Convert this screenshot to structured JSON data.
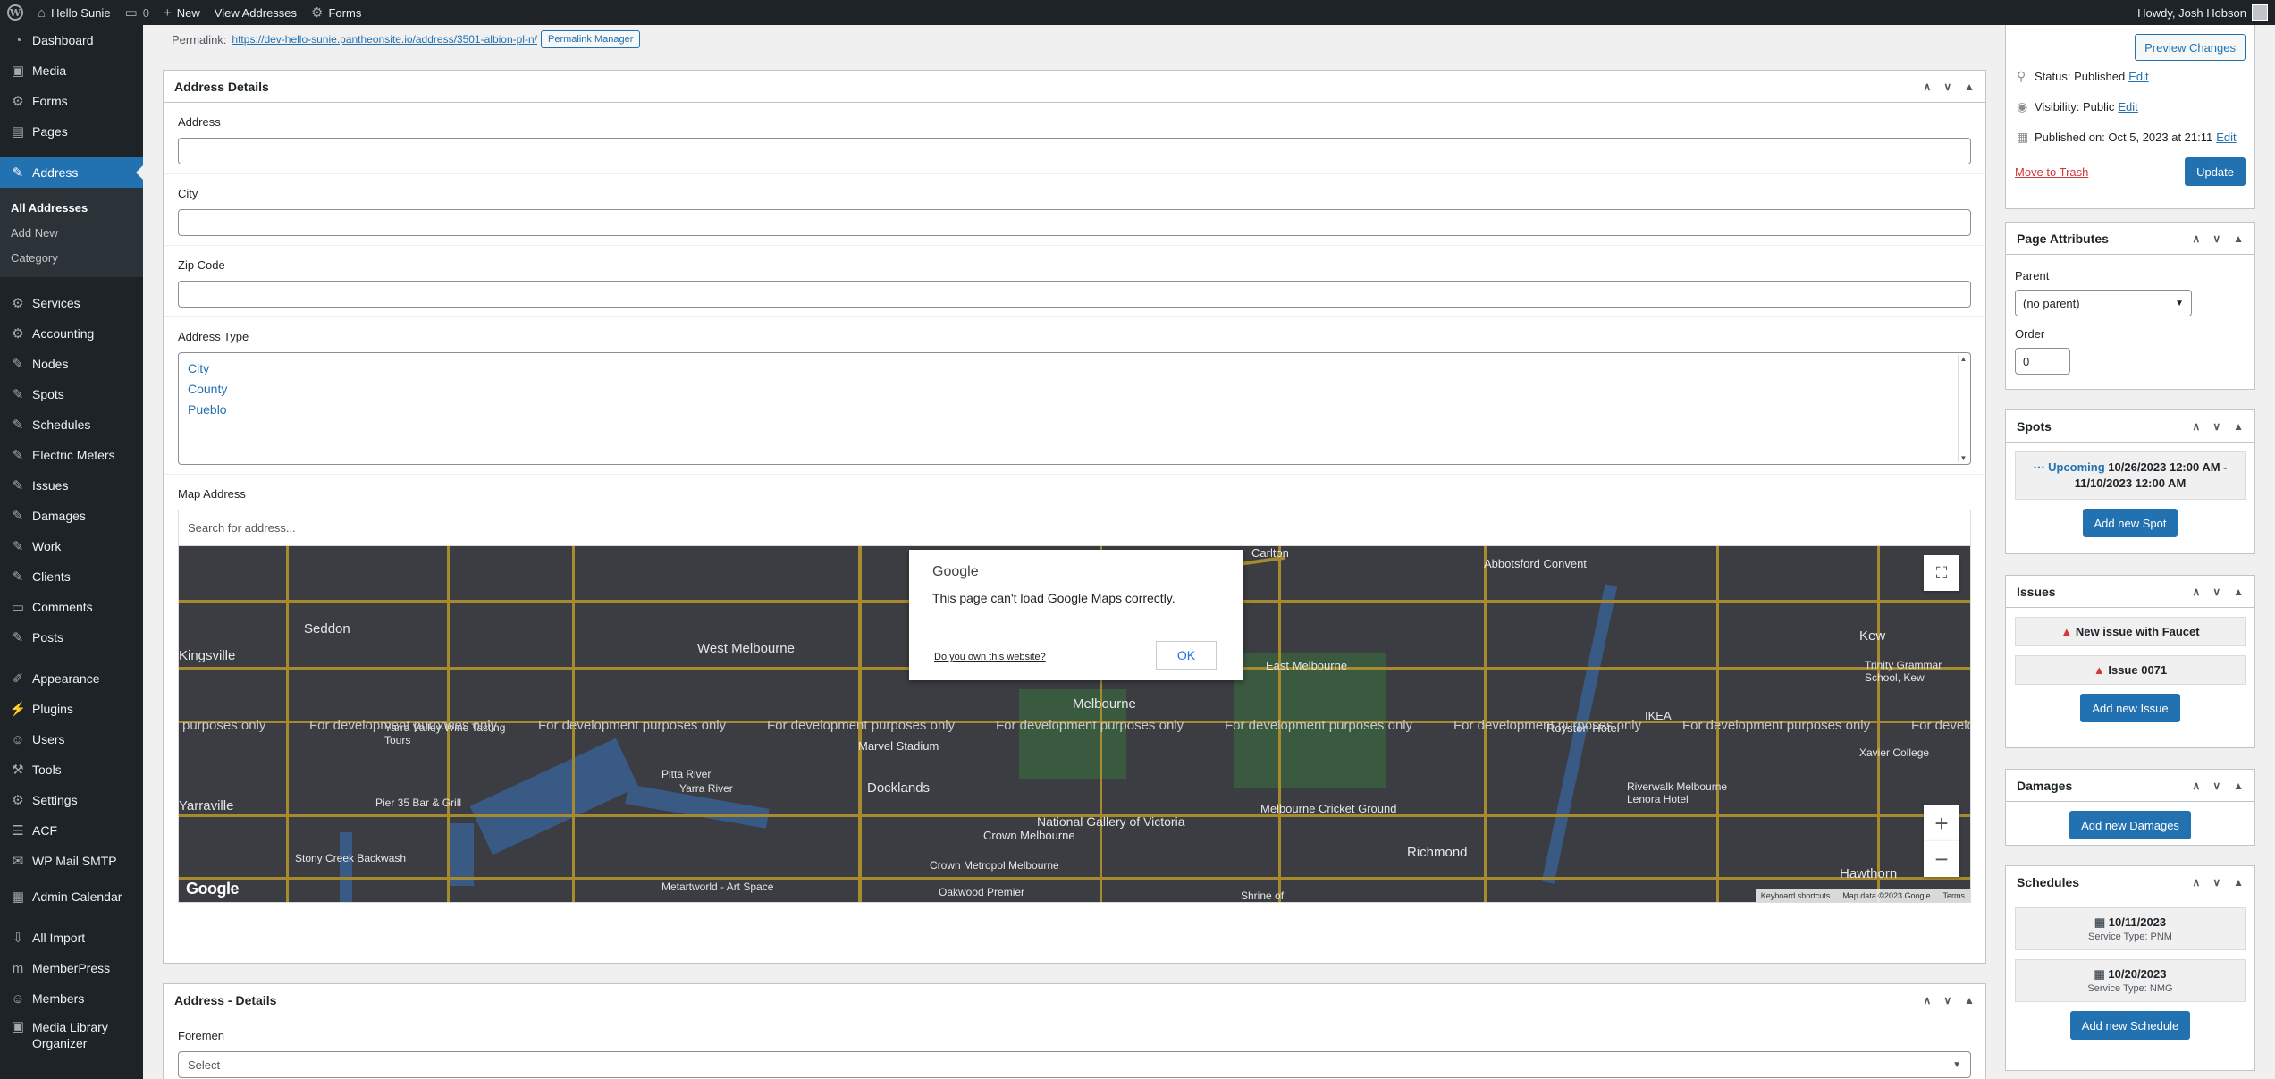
{
  "adminbar": {
    "site_name": "Hello Sunie",
    "comments_count": "0",
    "new_label": "New",
    "view_label": "View Addresses",
    "forms_label": "Forms",
    "howdy": "Howdy, Josh Hobson"
  },
  "sidebar": {
    "items_top": [
      {
        "label": "Dashboard",
        "icon": "dashboard-icon",
        "glyph": "◔"
      },
      {
        "label": "Media",
        "icon": "media-icon",
        "glyph": "▣"
      },
      {
        "label": "Forms",
        "icon": "forms-icon",
        "glyph": "⚙"
      },
      {
        "label": "Pages",
        "icon": "pages-icon",
        "glyph": "▤"
      }
    ],
    "active": {
      "label": "Address",
      "icon": "pin-icon",
      "glyph": "✎"
    },
    "submenu": [
      "All Addresses",
      "Add New",
      "Category"
    ],
    "items_mid": [
      {
        "label": "Services",
        "icon": "gear-icon",
        "glyph": "⚙"
      },
      {
        "label": "Accounting",
        "icon": "gear-icon",
        "glyph": "⚙"
      },
      {
        "label": "Nodes",
        "icon": "pin-icon",
        "glyph": "✎"
      },
      {
        "label": "Spots",
        "icon": "pin-icon",
        "glyph": "✎"
      },
      {
        "label": "Schedules",
        "icon": "pin-icon",
        "glyph": "✎"
      },
      {
        "label": "Electric Meters",
        "icon": "pin-icon",
        "glyph": "✎"
      },
      {
        "label": "Issues",
        "icon": "pin-icon",
        "glyph": "✎"
      },
      {
        "label": "Damages",
        "icon": "pin-icon",
        "glyph": "✎"
      },
      {
        "label": "Work",
        "icon": "pin-icon",
        "glyph": "✎"
      },
      {
        "label": "Clients",
        "icon": "pin-icon",
        "glyph": "✎"
      },
      {
        "label": "Comments",
        "icon": "comment-icon",
        "glyph": "▭"
      },
      {
        "label": "Posts",
        "icon": "pin-icon",
        "glyph": "✎"
      }
    ],
    "items_bottom": [
      {
        "label": "Appearance",
        "icon": "brush-icon",
        "glyph": "✐"
      },
      {
        "label": "Plugins",
        "icon": "plugin-icon",
        "glyph": "⚡"
      },
      {
        "label": "Users",
        "icon": "user-icon",
        "glyph": "☺"
      },
      {
        "label": "Tools",
        "icon": "wrench-icon",
        "glyph": "⚒"
      },
      {
        "label": "Settings",
        "icon": "settings-icon",
        "glyph": "⚙"
      },
      {
        "label": "ACF",
        "icon": "acf-icon",
        "glyph": "☰"
      },
      {
        "label": "WP Mail SMTP",
        "icon": "mail-icon",
        "glyph": "✉"
      }
    ],
    "admin_calendar": "Admin Calendar",
    "items_end": [
      {
        "label": "All Import",
        "icon": "import-icon",
        "glyph": "⇩"
      },
      {
        "label": "MemberPress",
        "icon": "memberpress-icon",
        "glyph": "m"
      },
      {
        "label": "Members",
        "icon": "members-icon",
        "glyph": "☺"
      }
    ],
    "media_library_organizer": "Media Library Organizer"
  },
  "permalink": {
    "label": "Permalink:",
    "url": "https://dev-hello-sunie.pantheonsite.io/address/3501-albion-pl-n/",
    "manager_button": "Permalink Manager"
  },
  "address_details": {
    "title": "Address Details",
    "address_label": "Address",
    "address_value": "",
    "city_label": "City",
    "city_value": "",
    "zip_label": "Zip Code",
    "zip_value": "",
    "type_label": "Address Type",
    "types": [
      "City",
      "County",
      "Pueblo"
    ],
    "map_label": "Map Address",
    "map_search_placeholder": "Search for address..."
  },
  "map": {
    "dialog_brand": "Google",
    "dialog_message": "This page can't load Google Maps correctly.",
    "dialog_link": "Do you own this website?",
    "dialog_ok": "OK",
    "dev_watermark": "For development purposes only",
    "dev_watermark_partial": "purposes only",
    "dev_watermark_start": "For develo",
    "places": [
      "Seddon",
      "West Melbourne",
      "Kingsville",
      "Yarraville",
      "Docklands",
      "Marvel Stadium",
      "Melbourne",
      "Crown Melbourne",
      "National Gallery of Victoria",
      "Richmond",
      "Hawthorn",
      "Kew",
      "Abbotsford Convent",
      "IKEA",
      "Royston Hotel",
      "Carlton",
      "East Melbourne",
      "Melbourne Cricket Ground",
      "Yarra Valley Wine Tasting Tours",
      "Stony Creek Backwash",
      "Pier 35 Bar & Grill",
      "Metartworld - Art Space",
      "Crown Metropol Melbourne",
      "Oakwood Premier",
      "Shrine of",
      "Xavier College",
      "Trinity Grammar School, Kew",
      "Riverwalk Melbourne",
      "Lenora Hotel",
      "Yarra River",
      "Pitta River"
    ],
    "google_logo": "Google",
    "footer": [
      "Keyboard shortcuts",
      "Map data ©2023 Google",
      "Terms"
    ]
  },
  "address_details2": {
    "title": "Address - Details",
    "foremen_label": "Foremen",
    "foremen_value": "Select"
  },
  "publish": {
    "preview_button": "Preview Changes",
    "status_label": "Status:",
    "status_value": "Published",
    "visibility_label": "Visibility:",
    "visibility_value": "Public",
    "published_label": "Published on:",
    "published_value": "Oct 5, 2023 at 21:11",
    "edit": "Edit",
    "trash": "Move to Trash",
    "update_button": "Update"
  },
  "page_attributes": {
    "title": "Page Attributes",
    "parent_label": "Parent",
    "parent_value": "(no parent)",
    "order_label": "Order",
    "order_value": "0"
  },
  "spots": {
    "title": "Spots",
    "upcoming_label": "Upcoming",
    "upcoming_dates": "10/26/2023 12:00 AM -",
    "upcoming_dates2": "11/10/2023 12:00 AM",
    "add_button": "Add new Spot"
  },
  "issues": {
    "title": "Issues",
    "items": [
      "New issue with Faucet",
      "Issue 0071"
    ],
    "add_button": "Add new Issue"
  },
  "damages": {
    "title": "Damages",
    "add_button": "Add new Damages"
  },
  "schedules": {
    "title": "Schedules",
    "items": [
      {
        "date": "10/11/2023",
        "type": "Service Type: PNM"
      },
      {
        "date": "10/20/2023",
        "type": "Service Type: NMG"
      }
    ],
    "add_button": "Add new Schedule"
  },
  "colors": {
    "admin_dark": "#1d2327",
    "accent": "#2271b1",
    "warning": "#d63638"
  }
}
